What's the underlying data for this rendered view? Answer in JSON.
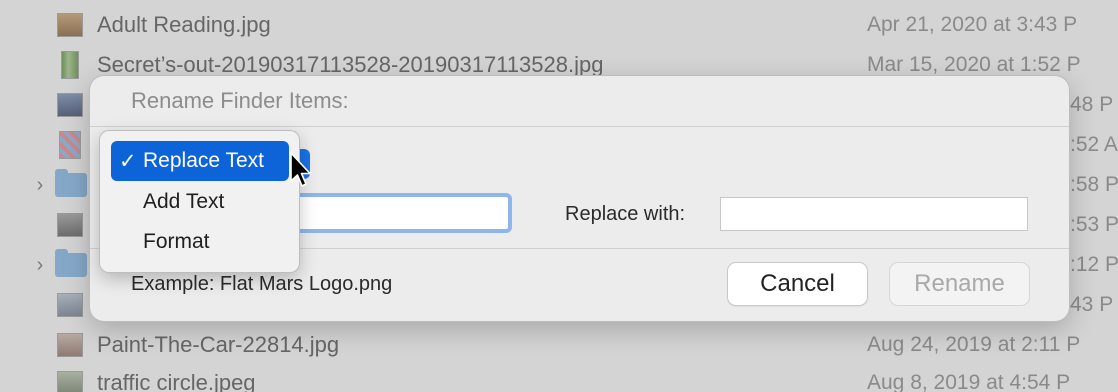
{
  "finder_list": {
    "rows": [
      {
        "name": "Adult Reading.jpg",
        "date": "Apr 21, 2020 at 3:43 P",
        "kind": "image"
      },
      {
        "name": "Secret’s-out-20190317113528-20190317113528.jpg",
        "date": "Mar 15, 2020 at 1:52 P",
        "kind": "image"
      },
      {
        "name": "",
        "date": "48 P",
        "kind": "image"
      },
      {
        "name": "",
        "date": ":52 A",
        "kind": "image"
      },
      {
        "name": "",
        "date": ":58 P",
        "kind": "folder"
      },
      {
        "name": "",
        "date": ":53 P",
        "kind": "image"
      },
      {
        "name": "",
        "date": ":12 P",
        "kind": "folder"
      },
      {
        "name": "",
        "date": "43 P",
        "kind": "image"
      },
      {
        "name": "Paint-The-Car-22814.jpg",
        "date": "Aug 24, 2019 at 2:11 P",
        "kind": "image"
      },
      {
        "name": "traffic circle.jpeg",
        "date": "Aug 8, 2019 at 4:54 P",
        "kind": "image"
      }
    ]
  },
  "dialog": {
    "title": "Rename Finder Items:",
    "replace_with_label": "Replace with:",
    "find_value": "",
    "replace_value": "",
    "example": "Example: Flat Mars Logo.png",
    "cancel_label": "Cancel",
    "rename_label": "Rename"
  },
  "popup_menu": {
    "check_glyph": "✓",
    "items": [
      {
        "label": "Replace Text",
        "selected": true
      },
      {
        "label": "Add Text",
        "selected": false
      },
      {
        "label": "Format",
        "selected": false
      }
    ]
  },
  "colors": {
    "accent": "#0d64d8",
    "focus_ring": "#8db6ee",
    "dialog_bg": "#ececec"
  }
}
